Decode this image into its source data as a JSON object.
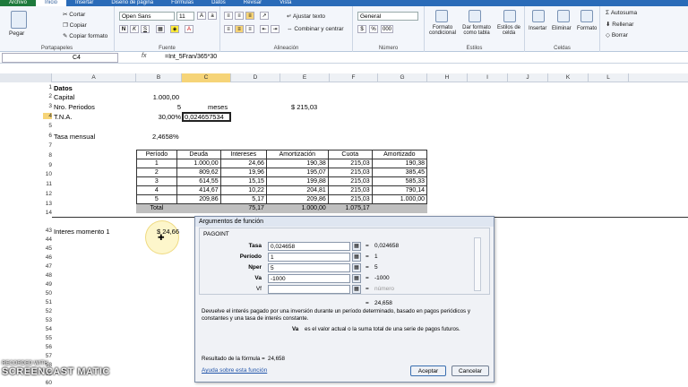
{
  "tabs": [
    "Archivo",
    "Inicio",
    "Insertar",
    "Diseño de página",
    "Fórmulas",
    "Datos",
    "Revisar",
    "Vista"
  ],
  "ribbon": {
    "clipboard": {
      "paste": "Pegar",
      "cut": "Cortar",
      "copy": "Copiar",
      "format_painter": "Copiar formato",
      "label": "Portapapeles"
    },
    "font": {
      "name": "Open Sans",
      "size": "11",
      "bold": "N",
      "italic": "K",
      "underline": "S",
      "label": "Fuente"
    },
    "alignment": {
      "wrap": "Ajustar texto",
      "merge": "Combinar y centrar",
      "label": "Alineación"
    },
    "number": {
      "format": "General",
      "currency": "$",
      "percent": "%",
      "thousands": "000",
      "label": "Número"
    },
    "styles": {
      "conditional": "Formato condicional",
      "as_table": "Dar formato como tabla",
      "cell_styles": "Estilos de celda",
      "label": "Estilos"
    },
    "cells": {
      "insert": "Insertar",
      "delete": "Eliminar",
      "format": "Formato",
      "label": "Celdas"
    },
    "editing": {
      "autosum": "Autosuma",
      "fill": "Rellenar",
      "clear": "Borrar"
    }
  },
  "formula_bar": {
    "name_box": "C4",
    "fx": "fx",
    "formula": "=Int_5Fran/365*30"
  },
  "columns": [
    "A",
    "B",
    "C",
    "D",
    "E",
    "F",
    "G",
    "H",
    "I",
    "J",
    "K",
    "L"
  ],
  "rows_top": [
    "1",
    "2",
    "3",
    "4",
    "5",
    "6",
    "7",
    "8",
    "9",
    "10",
    "11",
    "12",
    "13",
    "14"
  ],
  "rows_bottom": [
    "43",
    "44",
    "45",
    "46",
    "47",
    "48",
    "49",
    "50",
    "51",
    "52",
    "53",
    "54",
    "55",
    "56",
    "57",
    "58",
    "59",
    "60"
  ],
  "cells": {
    "a1": "Datos",
    "a2": "Capital",
    "b2": "1.000,00",
    "a3": "Nro. Periodos",
    "b3": "5",
    "c3": "meses",
    "e3": "$ 215,03",
    "a4": "T.N.A.",
    "b4": "30,00%",
    "c4": "0,024657534",
    "a6": "Tasa mensual",
    "b6": "2,4658%",
    "a43": "Interes momento 1",
    "b43": "$ 24,66"
  },
  "table": {
    "headers": [
      "Período",
      "Deuda",
      "Intereses",
      "Amortización",
      "Cuota",
      "Amortizado"
    ],
    "rows": [
      [
        "1",
        "1.000,00",
        "24,66",
        "190,38",
        "215,03",
        "190,38"
      ],
      [
        "2",
        "809,62",
        "19,96",
        "195,07",
        "215,03",
        "385,45"
      ],
      [
        "3",
        "614,55",
        "15,15",
        "199,88",
        "215,03",
        "585,33"
      ],
      [
        "4",
        "414,67",
        "10,22",
        "204,81",
        "215,03",
        "790,14"
      ],
      [
        "5",
        "209,86",
        "5,17",
        "209,86",
        "215,03",
        "1.000,00"
      ]
    ],
    "total": [
      "Total",
      "",
      "75,17",
      "1.000,00",
      "1.075,17",
      ""
    ]
  },
  "dialog": {
    "title": "Argumentos de función",
    "function": "PAGOINT",
    "args": [
      {
        "label": "Tasa",
        "value": "0,024658",
        "result": "0,024658"
      },
      {
        "label": "Período",
        "value": "1",
        "result": "1"
      },
      {
        "label": "Nper",
        "value": "5",
        "result": "5"
      },
      {
        "label": "Va",
        "value": "-1000",
        "result": "-1000"
      },
      {
        "label": "Vf",
        "value": "",
        "result": "número"
      }
    ],
    "result_value": "24,658",
    "description": "Devuelve el interés pagado por una inversión durante un período determinado, basado en pagos periódicos y constantes y una tasa de interés constante.",
    "arg_help_label": "Va",
    "arg_help": "es el valor actual o la suma total de una serie de pagos futuros.",
    "formula_result_label": "Resultado de la fórmula =",
    "formula_result": "24,658",
    "help_link": "Ayuda sobre esta función",
    "ok": "Aceptar",
    "cancel": "Cancelar"
  },
  "watermark": {
    "line1": "RECORDED WITH",
    "line2": "SCREENCAST MATIC"
  },
  "colors": {
    "accent": "#2a6bb8",
    "file_tab": "#1e7a3c",
    "selected_header": "#f6d478",
    "total_row": "#bfbfbf"
  }
}
